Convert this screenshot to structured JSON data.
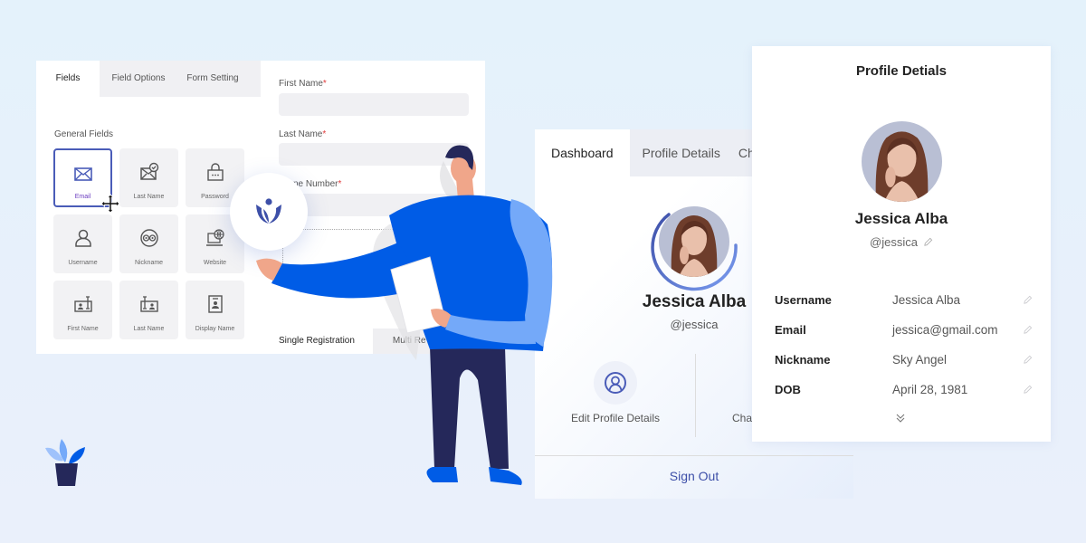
{
  "form_builder": {
    "tabs": [
      {
        "label": "Fields",
        "active": true
      },
      {
        "label": "Field Options",
        "active": false
      },
      {
        "label": "Form Setting",
        "active": false
      }
    ],
    "section_label": "General Fields",
    "fields": [
      {
        "label": "Email",
        "icon": "envelope-icon",
        "selected": true
      },
      {
        "label": "Last Name",
        "icon": "envelope-check-icon",
        "selected": false
      },
      {
        "label": "Password",
        "icon": "lock-icon",
        "selected": false
      },
      {
        "label": "Username",
        "icon": "user-icon",
        "selected": false
      },
      {
        "label": "Nickname",
        "icon": "eyes-icon",
        "selected": false
      },
      {
        "label": "Website",
        "icon": "globe-laptop-icon",
        "selected": false
      },
      {
        "label": "First Name",
        "icon": "id-card-text-icon",
        "selected": false
      },
      {
        "label": "Last Name",
        "icon": "id-card-text-icon",
        "selected": false
      },
      {
        "label": "Display Name",
        "icon": "id-badge-icon",
        "selected": false
      }
    ],
    "form_fields": [
      {
        "label": "First Name",
        "required_mark": "*",
        "value": ""
      },
      {
        "label": "Last Name",
        "required_mark": "*",
        "value": ""
      },
      {
        "label": "Phone Number",
        "visible_label": "ne Number",
        "required_mark": "*",
        "value": ""
      }
    ],
    "registration_tabs": [
      {
        "label": "Single Registration",
        "active": true
      },
      {
        "label": "Multi Registration",
        "visible_label": "Multi Re",
        "active": false
      }
    ]
  },
  "dashboard": {
    "tabs": [
      {
        "label": "Dashboard",
        "active": true
      },
      {
        "label": "Profile Details",
        "active": false
      },
      {
        "label": "Ch",
        "active": false
      }
    ],
    "user": {
      "name": "Jessica Alba",
      "handle": "@jessica"
    },
    "actions": [
      {
        "label": "Edit Profile Details",
        "icon": "user-circle-icon"
      },
      {
        "label": "Cha",
        "icon": ""
      }
    ],
    "sign_out_label": "Sign Out"
  },
  "profile_details": {
    "title": "Profile Detials",
    "user": {
      "name": "Jessica Alba",
      "handle": "@jessica"
    },
    "rows": [
      {
        "key": "Username",
        "value": "Jessica Alba"
      },
      {
        "key": "Email",
        "value": "jessica@gmail.com"
      },
      {
        "key": "Nickname",
        "value": "Sky Angel"
      },
      {
        "key": "DOB",
        "value": "April 28, 1981"
      }
    ]
  },
  "colors": {
    "brand": "#3d4fa8",
    "accent_blue": "#005ce6",
    "light_blue": "#74a9f9",
    "navy": "#25285a",
    "selected_border": "#4a5cb8",
    "required": "#e03a3a"
  }
}
